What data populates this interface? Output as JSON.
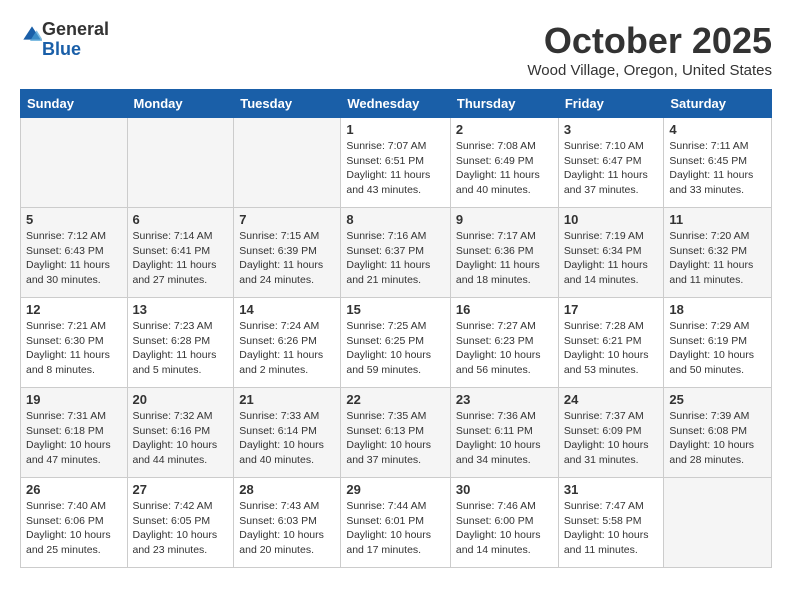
{
  "logo": {
    "general": "General",
    "blue": "Blue"
  },
  "title": "October 2025",
  "location": "Wood Village, Oregon, United States",
  "days_of_week": [
    "Sunday",
    "Monday",
    "Tuesday",
    "Wednesday",
    "Thursday",
    "Friday",
    "Saturday"
  ],
  "weeks": [
    [
      {
        "day": "",
        "info": ""
      },
      {
        "day": "",
        "info": ""
      },
      {
        "day": "",
        "info": ""
      },
      {
        "day": "1",
        "info": "Sunrise: 7:07 AM\nSunset: 6:51 PM\nDaylight: 11 hours\nand 43 minutes."
      },
      {
        "day": "2",
        "info": "Sunrise: 7:08 AM\nSunset: 6:49 PM\nDaylight: 11 hours\nand 40 minutes."
      },
      {
        "day": "3",
        "info": "Sunrise: 7:10 AM\nSunset: 6:47 PM\nDaylight: 11 hours\nand 37 minutes."
      },
      {
        "day": "4",
        "info": "Sunrise: 7:11 AM\nSunset: 6:45 PM\nDaylight: 11 hours\nand 33 minutes."
      }
    ],
    [
      {
        "day": "5",
        "info": "Sunrise: 7:12 AM\nSunset: 6:43 PM\nDaylight: 11 hours\nand 30 minutes."
      },
      {
        "day": "6",
        "info": "Sunrise: 7:14 AM\nSunset: 6:41 PM\nDaylight: 11 hours\nand 27 minutes."
      },
      {
        "day": "7",
        "info": "Sunrise: 7:15 AM\nSunset: 6:39 PM\nDaylight: 11 hours\nand 24 minutes."
      },
      {
        "day": "8",
        "info": "Sunrise: 7:16 AM\nSunset: 6:37 PM\nDaylight: 11 hours\nand 21 minutes."
      },
      {
        "day": "9",
        "info": "Sunrise: 7:17 AM\nSunset: 6:36 PM\nDaylight: 11 hours\nand 18 minutes."
      },
      {
        "day": "10",
        "info": "Sunrise: 7:19 AM\nSunset: 6:34 PM\nDaylight: 11 hours\nand 14 minutes."
      },
      {
        "day": "11",
        "info": "Sunrise: 7:20 AM\nSunset: 6:32 PM\nDaylight: 11 hours\nand 11 minutes."
      }
    ],
    [
      {
        "day": "12",
        "info": "Sunrise: 7:21 AM\nSunset: 6:30 PM\nDaylight: 11 hours\nand 8 minutes."
      },
      {
        "day": "13",
        "info": "Sunrise: 7:23 AM\nSunset: 6:28 PM\nDaylight: 11 hours\nand 5 minutes."
      },
      {
        "day": "14",
        "info": "Sunrise: 7:24 AM\nSunset: 6:26 PM\nDaylight: 11 hours\nand 2 minutes."
      },
      {
        "day": "15",
        "info": "Sunrise: 7:25 AM\nSunset: 6:25 PM\nDaylight: 10 hours\nand 59 minutes."
      },
      {
        "day": "16",
        "info": "Sunrise: 7:27 AM\nSunset: 6:23 PM\nDaylight: 10 hours\nand 56 minutes."
      },
      {
        "day": "17",
        "info": "Sunrise: 7:28 AM\nSunset: 6:21 PM\nDaylight: 10 hours\nand 53 minutes."
      },
      {
        "day": "18",
        "info": "Sunrise: 7:29 AM\nSunset: 6:19 PM\nDaylight: 10 hours\nand 50 minutes."
      }
    ],
    [
      {
        "day": "19",
        "info": "Sunrise: 7:31 AM\nSunset: 6:18 PM\nDaylight: 10 hours\nand 47 minutes."
      },
      {
        "day": "20",
        "info": "Sunrise: 7:32 AM\nSunset: 6:16 PM\nDaylight: 10 hours\nand 44 minutes."
      },
      {
        "day": "21",
        "info": "Sunrise: 7:33 AM\nSunset: 6:14 PM\nDaylight: 10 hours\nand 40 minutes."
      },
      {
        "day": "22",
        "info": "Sunrise: 7:35 AM\nSunset: 6:13 PM\nDaylight: 10 hours\nand 37 minutes."
      },
      {
        "day": "23",
        "info": "Sunrise: 7:36 AM\nSunset: 6:11 PM\nDaylight: 10 hours\nand 34 minutes."
      },
      {
        "day": "24",
        "info": "Sunrise: 7:37 AM\nSunset: 6:09 PM\nDaylight: 10 hours\nand 31 minutes."
      },
      {
        "day": "25",
        "info": "Sunrise: 7:39 AM\nSunset: 6:08 PM\nDaylight: 10 hours\nand 28 minutes."
      }
    ],
    [
      {
        "day": "26",
        "info": "Sunrise: 7:40 AM\nSunset: 6:06 PM\nDaylight: 10 hours\nand 25 minutes."
      },
      {
        "day": "27",
        "info": "Sunrise: 7:42 AM\nSunset: 6:05 PM\nDaylight: 10 hours\nand 23 minutes."
      },
      {
        "day": "28",
        "info": "Sunrise: 7:43 AM\nSunset: 6:03 PM\nDaylight: 10 hours\nand 20 minutes."
      },
      {
        "day": "29",
        "info": "Sunrise: 7:44 AM\nSunset: 6:01 PM\nDaylight: 10 hours\nand 17 minutes."
      },
      {
        "day": "30",
        "info": "Sunrise: 7:46 AM\nSunset: 6:00 PM\nDaylight: 10 hours\nand 14 minutes."
      },
      {
        "day": "31",
        "info": "Sunrise: 7:47 AM\nSunset: 5:58 PM\nDaylight: 10 hours\nand 11 minutes."
      },
      {
        "day": "",
        "info": ""
      }
    ]
  ]
}
